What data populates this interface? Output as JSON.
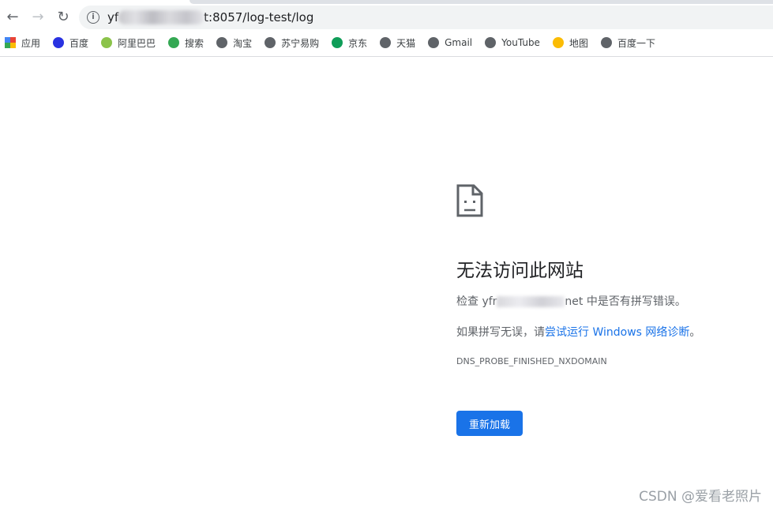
{
  "browser": {
    "url_prefix": "yf",
    "url_suffix": "t:8057/log-test/log",
    "bookmarks": [
      {
        "label": "应用",
        "icon": "apps-grid-icon",
        "color": "#ea4335"
      },
      {
        "label": "百度",
        "icon": "baidu-paw-icon",
        "color": "#2932e1"
      },
      {
        "label": "阿里巴巴",
        "icon": "leaf-icon",
        "color": "#8bc34a"
      },
      {
        "label": "搜索",
        "icon": "search-ring-icon",
        "color": "#34a853"
      },
      {
        "label": "淘宝",
        "icon": "globe-icon",
        "color": "#5f6368"
      },
      {
        "label": "苏宁易购",
        "icon": "globe-icon",
        "color": "#5f6368"
      },
      {
        "label": "京东",
        "icon": "jd-icon",
        "color": "#0f9d58"
      },
      {
        "label": "天猫",
        "icon": "globe-icon",
        "color": "#5f6368"
      },
      {
        "label": "Gmail",
        "icon": "globe-icon",
        "color": "#5f6368"
      },
      {
        "label": "YouTube",
        "icon": "globe-icon",
        "color": "#5f6368"
      },
      {
        "label": "地图",
        "icon": "maps-icon",
        "color": "#fbbc04"
      },
      {
        "label": "百度一下",
        "icon": "globe-icon",
        "color": "#5f6368"
      }
    ]
  },
  "error": {
    "title": "无法访问此网站",
    "check_prefix": "检查 yfr",
    "check_suffix": "net 中是否有拼写错误。",
    "hint_prefix": "如果拼写无误，请",
    "hint_link": "尝试运行 Windows 网络诊断",
    "hint_suffix": "。",
    "code": "DNS_PROBE_FINISHED_NXDOMAIN",
    "reload_label": "重新加载"
  },
  "watermark": "CSDN @爱看老照片"
}
